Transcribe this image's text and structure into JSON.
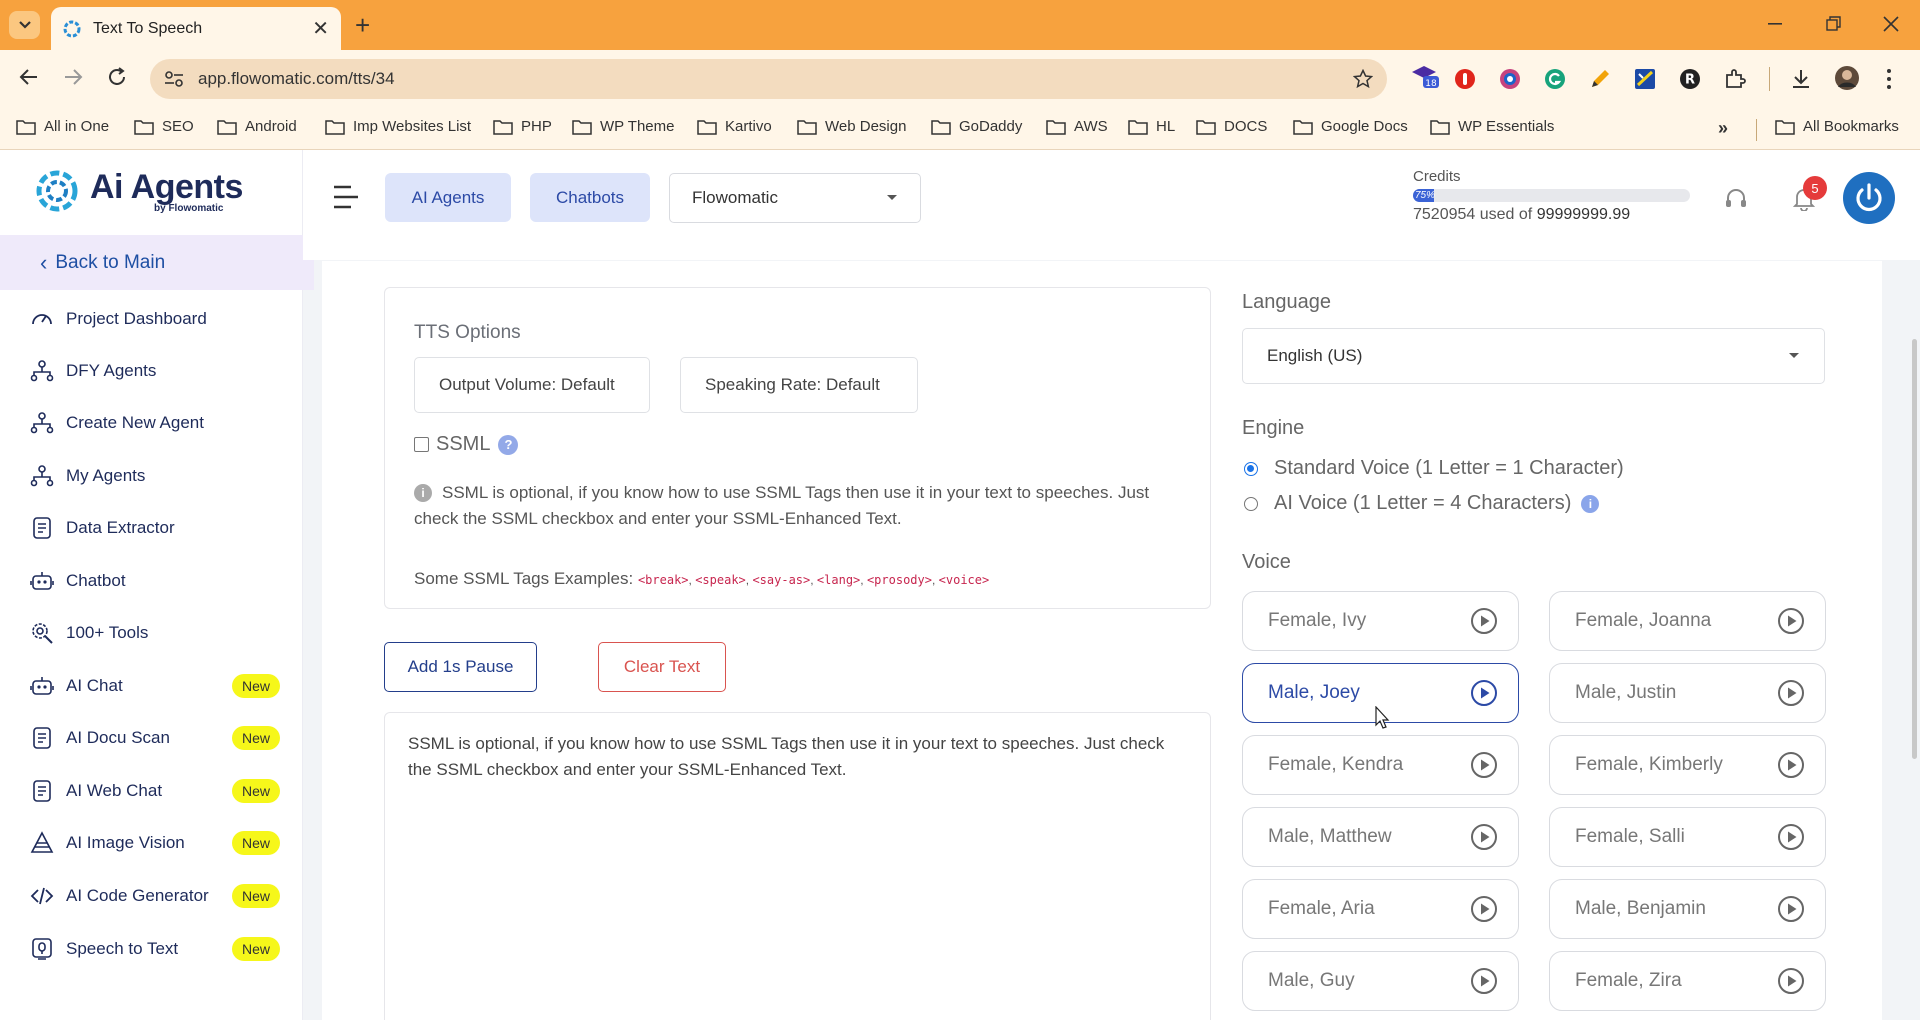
{
  "browser": {
    "tab_title": "Text To Speech",
    "url": "app.flowomatic.com/tts/34",
    "extension_badge": "18",
    "bookmarks": [
      "All in One",
      "SEO",
      "Android",
      "Imp Websites List",
      "PHP",
      "WP Theme",
      "Kartivo",
      "Web Design",
      "GoDaddy",
      "AWS",
      "HL",
      "DOCS",
      "Google Docs",
      "WP Essentials"
    ],
    "more_bookmarks": "»",
    "all_bookmarks": "All Bookmarks"
  },
  "brand": {
    "name": "Ai Agents",
    "sub": "by Flowomatic",
    "accent": "#2c4aa6"
  },
  "sidebar": {
    "back_label": "Back to Main",
    "items": [
      {
        "label": "Project Dashboard",
        "icon": "gauge-icon",
        "badge": ""
      },
      {
        "label": "DFY Agents",
        "icon": "agent-tree-icon",
        "badge": ""
      },
      {
        "label": "Create New Agent",
        "icon": "agent-tree-icon",
        "badge": ""
      },
      {
        "label": "My Agents",
        "icon": "agent-tree-icon",
        "badge": ""
      },
      {
        "label": "Data Extractor",
        "icon": "document-icon",
        "badge": ""
      },
      {
        "label": "Chatbot",
        "icon": "robot-icon",
        "badge": ""
      },
      {
        "label": "100+ Tools",
        "icon": "gear-search-icon",
        "badge": ""
      },
      {
        "label": "AI Chat",
        "icon": "robot-icon",
        "badge": "New"
      },
      {
        "label": "AI Docu Scan",
        "icon": "document-icon",
        "badge": "New"
      },
      {
        "label": "AI Web Chat",
        "icon": "document-icon",
        "badge": "New"
      },
      {
        "label": "AI Image Vision",
        "icon": "pyramid-icon",
        "badge": "New"
      },
      {
        "label": "AI Code Generator",
        "icon": "code-icon",
        "badge": "New"
      },
      {
        "label": "Speech to Text",
        "icon": "speech-doc-icon",
        "badge": "New"
      }
    ]
  },
  "header": {
    "chip_agents": "AI Agents",
    "chip_chatbots": "Chatbots",
    "workspace": "Flowomatic",
    "credits_label": "Credits",
    "credits_pct_label": "75%",
    "credits_fraction": 0.075,
    "credits_used": "7520954",
    "credits_sep": "used of",
    "credits_total": "99999999.99",
    "notifications": "5"
  },
  "tts": {
    "options_title": "TTS Options",
    "output_volume": "Output Volume: Default",
    "speaking_rate": "Speaking Rate: Default",
    "ssml_label": "SSML",
    "ssml_help": "?",
    "ssml_info": "SSML is optional, if you know how to use SSML Tags then use it in your text to speeches. Just check the SSML checkbox and enter your SSML-Enhanced Text.",
    "tags_label": "Some SSML Tags Examples:",
    "tags": [
      "<break>",
      "<speak>",
      "<say-as>",
      "<lang>",
      "<prosody>",
      "<voice>"
    ],
    "add_pause": "Add 1s Pause",
    "clear_text": "Clear Text",
    "text": "SSML is optional, if you know how to use SSML Tags then use it in your text to speeches. Just check the SSML checkbox and enter your SSML-Enhanced Text."
  },
  "settings": {
    "language_label": "Language",
    "language": "English (US)",
    "engine_label": "Engine",
    "engine_standard": "Standard Voice (1 Letter = 1 Character)",
    "engine_ai": "AI Voice (1 Letter = 4 Characters)",
    "voice_label": "Voice",
    "voices": [
      {
        "label": "Female, Ivy",
        "selected": false
      },
      {
        "label": "Female, Joanna",
        "selected": false
      },
      {
        "label": "Male, Joey",
        "selected": true
      },
      {
        "label": "Male, Justin",
        "selected": false
      },
      {
        "label": "Female, Kendra",
        "selected": false
      },
      {
        "label": "Female, Kimberly",
        "selected": false
      },
      {
        "label": "Male, Matthew",
        "selected": false
      },
      {
        "label": "Female, Salli",
        "selected": false
      },
      {
        "label": "Female, Aria",
        "selected": false
      },
      {
        "label": "Male, Benjamin",
        "selected": false
      },
      {
        "label": "Male, Guy",
        "selected": false
      },
      {
        "label": "Female, Zira",
        "selected": false
      }
    ]
  }
}
